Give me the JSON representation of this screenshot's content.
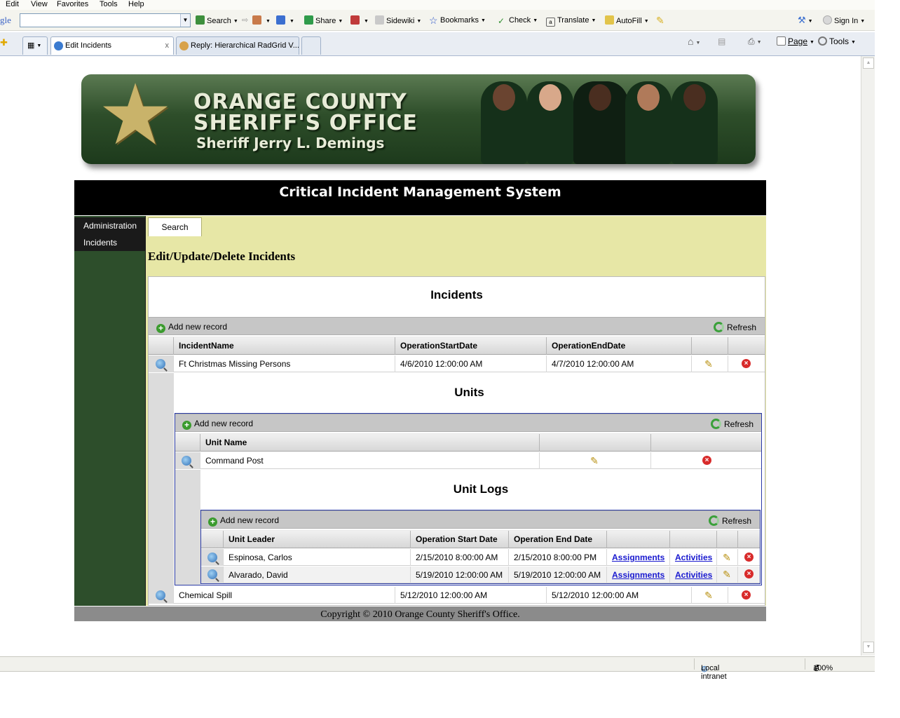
{
  "browser": {
    "menu": [
      "Edit",
      "View",
      "Favorites",
      "Tools",
      "Help"
    ],
    "google_label": "gle",
    "toolbar": {
      "search": "Search",
      "share": "Share",
      "sidewiki": "Sidewiki",
      "bookmarks": "Bookmarks",
      "check": "Check",
      "translate": "Translate",
      "autofill": "AutoFill",
      "sign_in": "Sign In"
    },
    "tabs": [
      {
        "label": "Edit Incidents",
        "close": "x"
      },
      {
        "label": "Reply: Hierarchical RadGrid V..."
      }
    ],
    "command_bar": {
      "page": "Page",
      "tools": "Tools"
    },
    "status": {
      "zone": "Local intranet",
      "zoom": "100%"
    }
  },
  "banner": {
    "line1": "ORANGE COUNTY",
    "line2": "SHERIFF'S OFFICE",
    "line3": "Sheriff Jerry L. Demings"
  },
  "system_title": "Critical Incident Management System",
  "nav": [
    "Administration",
    "Incidents"
  ],
  "search_tab": "Search",
  "page_heading": "Edit/Update/Delete Incidents",
  "incidents": {
    "title": "Incidents",
    "add_label": "Add new record",
    "refresh_label": "Refresh",
    "columns": [
      "IncidentName",
      "OperationStartDate",
      "OperationEndDate"
    ],
    "rows": [
      {
        "name": "Ft Christmas Missing Persons",
        "start": "4/6/2010 12:00:00 AM",
        "end": "4/7/2010 12:00:00 AM"
      },
      {
        "name": "Chemical Spill",
        "start": "5/12/2010 12:00:00 AM",
        "end": "5/12/2010 12:00:00 AM"
      }
    ]
  },
  "units": {
    "title": "Units",
    "add_label": "Add new record",
    "refresh_label": "Refresh",
    "columns": [
      "Unit Name"
    ],
    "rows": [
      {
        "name": "Command Post"
      }
    ]
  },
  "unit_logs": {
    "title": "Unit Logs",
    "add_label": "Add new record",
    "refresh_label": "Refresh",
    "columns": [
      "Unit Leader",
      "Operation Start Date",
      "Operation End Date"
    ],
    "rows": [
      {
        "leader": "Espinosa, Carlos",
        "start": "2/15/2010 8:00:00 AM",
        "end": "2/15/2010 8:00:00 PM",
        "assignments": "Assignments",
        "activities": "Activities"
      },
      {
        "leader": "Alvarado, David",
        "start": "5/19/2010 12:00:00 AM",
        "end": "5/19/2010 12:00:00 AM",
        "assignments": "Assignments",
        "activities": "Activities"
      }
    ]
  },
  "footer": "Copyright © 2010 Orange County Sheriff's Office.",
  "colors": {
    "nav_green": "#2d4e2b",
    "content_yellow": "#e7e7a6",
    "nested_border": "#2a3aa5",
    "link_blue": "#1a1ad0"
  }
}
